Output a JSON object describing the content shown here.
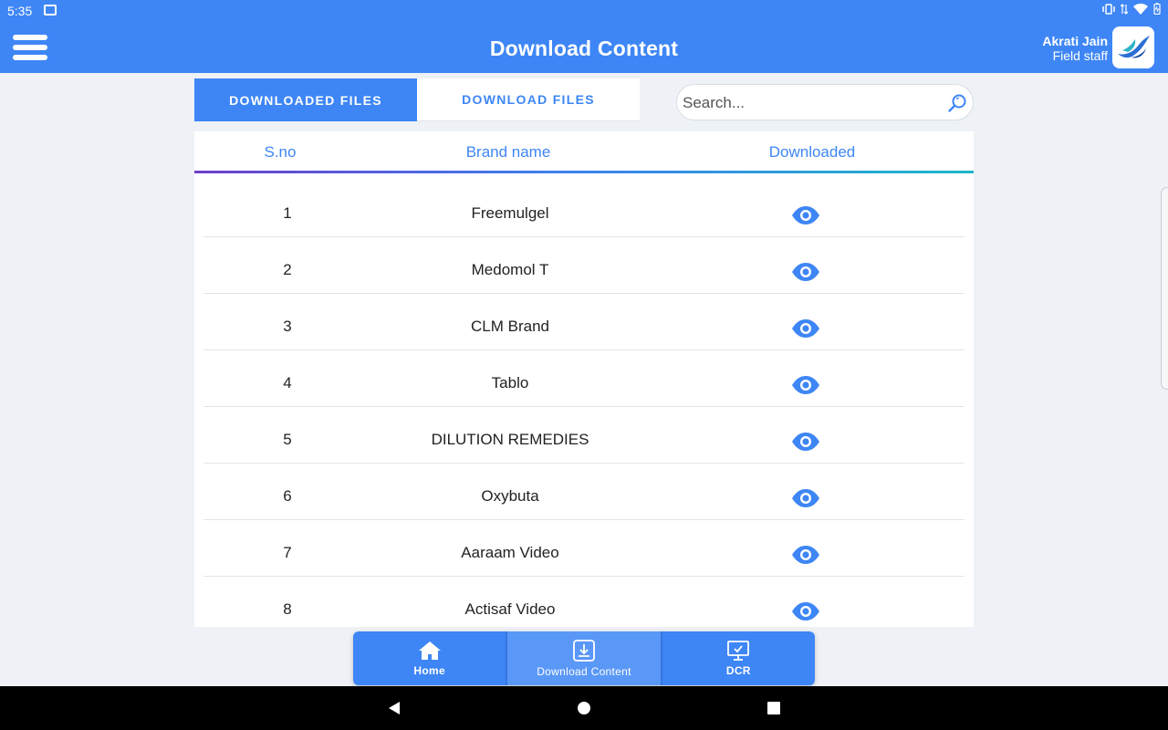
{
  "status_bar": {
    "time": "5:35"
  },
  "header": {
    "title": "Download Content",
    "user_name": "Akrati Jain",
    "user_role": "Field staff"
  },
  "tabs": [
    {
      "label": "DOWNLOADED FILES",
      "active": true
    },
    {
      "label": "DOWNLOAD FILES",
      "active": false
    }
  ],
  "search": {
    "placeholder": "Search...",
    "value": ""
  },
  "table": {
    "columns": [
      "S.no",
      "Brand name",
      "Downloaded"
    ],
    "rows": [
      {
        "sno": "1",
        "brand": "Freemulgel"
      },
      {
        "sno": "2",
        "brand": "Medomol T"
      },
      {
        "sno": "3",
        "brand": "CLM Brand"
      },
      {
        "sno": "4",
        "brand": "Tablo"
      },
      {
        "sno": "5",
        "brand": "DILUTION REMEDIES"
      },
      {
        "sno": "6",
        "brand": "Oxybuta"
      },
      {
        "sno": "7",
        "brand": "Aaraam Video"
      },
      {
        "sno": "8",
        "brand": "Actisaf Video"
      }
    ]
  },
  "bottom_nav": [
    {
      "label": "Home",
      "icon": "home-icon",
      "active": false
    },
    {
      "label": "Download Content",
      "icon": "download-icon",
      "active": true
    },
    {
      "label": "DCR",
      "icon": "monitor-check-icon",
      "active": false
    }
  ],
  "colors": {
    "primary": "#3e86f5",
    "background": "#eef1f6",
    "eye_icon": "#3e86f5"
  }
}
